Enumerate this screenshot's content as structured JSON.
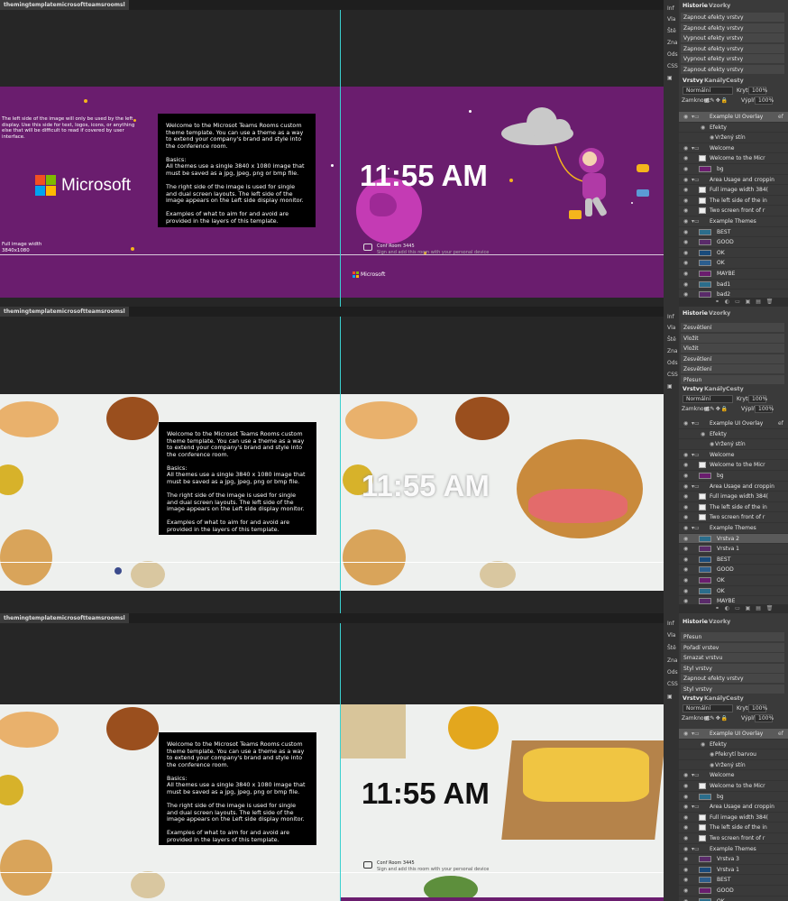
{
  "tab_title": "themingtemplatemicrosoftteamsroomsl",
  "side_strip": [
    "Inf",
    "Vla",
    "Ště",
    "Zna",
    "Ods",
    "CSS"
  ],
  "panel_tabs": {
    "history": "Historie",
    "swatches": "Vzorky",
    "layers": "Vrstvy",
    "channels": "Kanály",
    "paths": "Cesty"
  },
  "controls": {
    "blend": "Normální",
    "opacity_label": "Krytí:",
    "opacity": "100%",
    "lock_label": "Zamknout:",
    "fill_label": "Výplň:",
    "fill": "100%"
  },
  "left_info": "The left side of the image will only be used by the left display. Use this side for text, logos, icons, or anything else that will be difficult to read if covered by user interface.",
  "full_width": "Full image width\n3840x1080",
  "welcome": {
    "p1": "Welcome to the Microsot Teams Rooms custom theme template. You can use a theme as a way to extend your company's brand and style into the conference room.",
    "p2": "Basics:\nAll themes use a single 3840 x 1080 image that must be saved as a jpg, jpeg, png or bmp file.",
    "p3": "The right side of the image is used for single and dual screen layouts. The left side of the image appears on the Left side display monitor.",
    "p4": "Examples of what to aim for and avoid are provided in the layers of this template."
  },
  "clock": "11:55 AM",
  "microsoft": "Microsoft",
  "room_name": "Conf Room 3445",
  "room_sub": "Sign and add this room with your personal device",
  "colors": {
    "purple": "#6a1d6e",
    "bg": "#262626",
    "panel": "#3a3a3a",
    "guide": "#3ad0d0"
  },
  "panes": [
    {
      "history": [
        "Zapnout efekty vrstvy",
        "Zapnout efekty vrstvy",
        "Vypnout efekty vrstvy",
        "Zapnout efekty vrstvy",
        "Vypnout efekty vrstvy",
        "Zapnout efekty vrstvy"
      ],
      "layers": [
        {
          "name": "Example UI Overlay",
          "kind": "group-open",
          "sel": true,
          "tag": "eff"
        },
        {
          "name": "Efekty",
          "kind": "fx"
        },
        {
          "name": "Vržený stín",
          "kind": "fx2"
        },
        {
          "name": "Welcome",
          "kind": "folder"
        },
        {
          "name": "Welcome to the Micr",
          "kind": "text"
        },
        {
          "name": "bg",
          "kind": "thumb"
        },
        {
          "name": "Area Usage and croppin",
          "kind": "folder"
        },
        {
          "name": "Full image width 384(",
          "kind": "text"
        },
        {
          "name": "The left side of the in",
          "kind": "text"
        },
        {
          "name": "Two screen front of r",
          "kind": "text"
        },
        {
          "name": "Example Themes",
          "kind": "folder"
        },
        {
          "name": "BEST",
          "kind": "thumb"
        },
        {
          "name": "GOOD",
          "kind": "thumb"
        },
        {
          "name": "OK",
          "kind": "thumb"
        },
        {
          "name": "OK",
          "kind": "thumb"
        },
        {
          "name": "MAYBE",
          "kind": "thumb"
        },
        {
          "name": "bad1",
          "kind": "thumb"
        },
        {
          "name": "bad2",
          "kind": "thumb"
        }
      ]
    },
    {
      "history": [
        "Zesvětlení",
        "Vložit",
        "Vložit",
        "Zesvětlení",
        "Zesvětlení",
        "Přesun"
      ],
      "layers": [
        {
          "name": "Example UI Overlay",
          "kind": "group-open",
          "tag": "eff"
        },
        {
          "name": "Efekty",
          "kind": "fx"
        },
        {
          "name": "Vržený stín",
          "kind": "fx2"
        },
        {
          "name": "Welcome",
          "kind": "folder"
        },
        {
          "name": "Welcome to the Micr",
          "kind": "text"
        },
        {
          "name": "bg",
          "kind": "thumb"
        },
        {
          "name": "Area Usage and croppin",
          "kind": "folder"
        },
        {
          "name": "Full image width 384(",
          "kind": "text"
        },
        {
          "name": "The left side of the in",
          "kind": "text"
        },
        {
          "name": "Two screen front of r",
          "kind": "text"
        },
        {
          "name": "Example Themes",
          "kind": "folder"
        },
        {
          "name": "Vrstva 2",
          "kind": "thumb",
          "sel": true
        },
        {
          "name": "Vrstva 1",
          "kind": "thumb"
        },
        {
          "name": "BEST",
          "kind": "thumb"
        },
        {
          "name": "GOOD",
          "kind": "thumb"
        },
        {
          "name": "OK",
          "kind": "thumb"
        },
        {
          "name": "OK",
          "kind": "thumb"
        },
        {
          "name": "MAYBE",
          "kind": "thumb"
        }
      ]
    },
    {
      "history": [
        "Přesun",
        "Pořadí vrstev",
        "Smazat vrstvu",
        "Styl vrstvy",
        "Zapnout efekty vrstvy",
        "Styl vrstvy"
      ],
      "layers": [
        {
          "name": "Example UI Overlay",
          "kind": "group-open",
          "sel": true,
          "tag": "eff"
        },
        {
          "name": "Efekty",
          "kind": "fx"
        },
        {
          "name": "Překrytí barvou",
          "kind": "fx2"
        },
        {
          "name": "Vržený stín",
          "kind": "fx2"
        },
        {
          "name": "Welcome",
          "kind": "folder"
        },
        {
          "name": "Welcome to the Micr",
          "kind": "text"
        },
        {
          "name": "bg",
          "kind": "thumb"
        },
        {
          "name": "Area Usage and croppin",
          "kind": "folder"
        },
        {
          "name": "Full image width 384(",
          "kind": "text"
        },
        {
          "name": "The left side of the in",
          "kind": "text"
        },
        {
          "name": "Two screen front of r",
          "kind": "text"
        },
        {
          "name": "Example Themes",
          "kind": "folder"
        },
        {
          "name": "Vrstva 3",
          "kind": "thumb"
        },
        {
          "name": "Vrstva 1",
          "kind": "thumb"
        },
        {
          "name": "BEST",
          "kind": "thumb"
        },
        {
          "name": "GOOD",
          "kind": "thumb"
        },
        {
          "name": "OK",
          "kind": "thumb"
        }
      ]
    }
  ]
}
